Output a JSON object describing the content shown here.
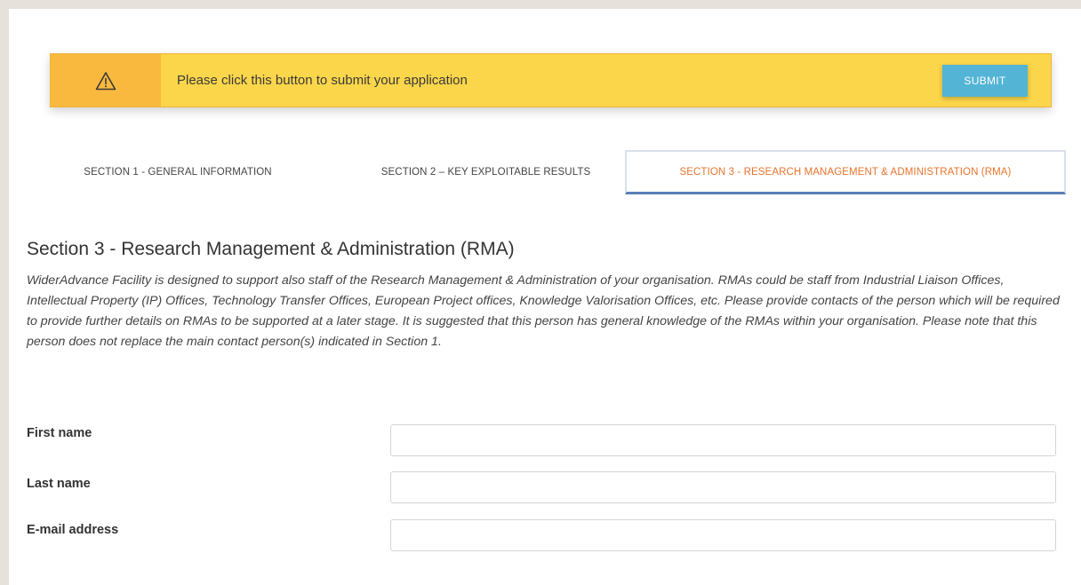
{
  "alert": {
    "icon": "warning-triangle-icon",
    "message": "Please click this button to submit your application",
    "submit_label": "SUBMIT"
  },
  "tabs": [
    {
      "label": "SECTION 1 - GENERAL INFORMATION",
      "active": false
    },
    {
      "label": "SECTION 2 – KEY EXPLOITABLE RESULTS",
      "active": false
    },
    {
      "label": "SECTION 3 - RESEARCH MANAGEMENT & ADMINISTRATION (RMA)",
      "active": true
    }
  ],
  "section": {
    "title": "Section 3 - Research Management & Administration (RMA)",
    "description": "WiderAdvance Facility is designed to support also staff of the Research Management & Administration of your organisation. RMAs could be staff from Industrial Liaison Offices, Intellectual Property (IP) Offices, Technology Transfer Offices, European Project offices, Knowledge Valorisation Offices, etc. Please provide contacts of the person which will be required to provide further details on RMAs to be supported at a later stage. It is suggested that this person has general knowledge of the RMAs within your organisation. Please note that this person does not replace the main contact person(s) indicated in Section 1."
  },
  "form": {
    "first_name_label": "First name",
    "first_name_value": "",
    "last_name_label": "Last name",
    "last_name_value": "",
    "email_label": "E-mail address",
    "email_value": ""
  },
  "colors": {
    "banner": "#fbd64a",
    "banner_icon_bg": "#f9b93f",
    "submit_button": "#53b4d6",
    "active_tab_text": "#e8742c",
    "active_tab_underline": "#5a7fb8"
  }
}
